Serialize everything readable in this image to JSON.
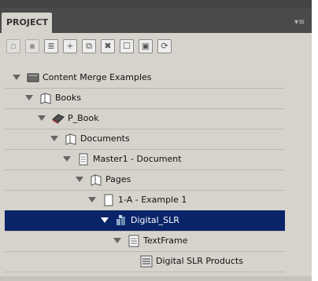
{
  "panel": {
    "tab_label": "PROJECT",
    "menu_icon": "panel-menu-icon"
  },
  "toolbar": {
    "buttons": [
      {
        "name": "toolbar-button-1",
        "glyph": "▫"
      },
      {
        "name": "toolbar-button-2",
        "glyph": "▪"
      },
      {
        "name": "toolbar-button-3",
        "glyph": "≣"
      },
      {
        "name": "toolbar-button-4",
        "glyph": "+"
      },
      {
        "name": "toolbar-button-5",
        "glyph": "⧉"
      },
      {
        "name": "toolbar-button-6",
        "glyph": "✖"
      },
      {
        "name": "toolbar-button-7",
        "glyph": "☐"
      },
      {
        "name": "toolbar-button-8",
        "glyph": "▣"
      },
      {
        "name": "toolbar-button-9",
        "glyph": "⟳"
      }
    ]
  },
  "tree": {
    "items": [
      {
        "label": "Content Merge Examples",
        "icon": "project-book-icon"
      },
      {
        "label": "Books",
        "icon": "folder-icon"
      },
      {
        "label": "P_Book",
        "icon": "book-icon"
      },
      {
        "label": "Documents",
        "icon": "folder-icon"
      },
      {
        "label": "Master1 - Document",
        "icon": "document-icon"
      },
      {
        "label": "Pages",
        "icon": "folder-icon"
      },
      {
        "label": "1-A - Example 1",
        "icon": "page-icon"
      },
      {
        "label": "Digital_SLR",
        "icon": "layer-icon"
      },
      {
        "label": "TextFrame",
        "icon": "text-frame-icon"
      },
      {
        "label": "Digital SLR Products",
        "icon": "text-block-icon"
      }
    ]
  }
}
